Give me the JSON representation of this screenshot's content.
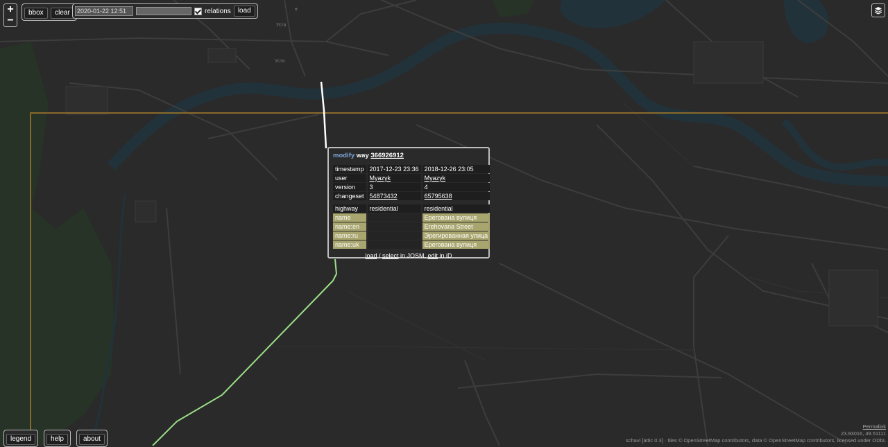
{
  "map": {
    "place_labels": [
      "Устя",
      "Устя"
    ],
    "colors": {
      "background": "#2a2a2a",
      "river": "#23333b",
      "forest": "#253525",
      "road": "#3c3c3c",
      "bbox": "#8a6a2a",
      "way_old": "#ffffff",
      "way_new": "#9ce087"
    }
  },
  "controls": {
    "zoom_in": "+",
    "zoom_out": "−",
    "bbox_label": "bbox",
    "clear_label": "clear",
    "date_value": "2020-01-22 12:51",
    "relations_label": "relations",
    "relations_checked": true,
    "load_label": "load",
    "layers_icon": "layers-icon"
  },
  "popup": {
    "action": "modify",
    "type": "way",
    "id": "366926912",
    "meta": [
      {
        "key": "timestamp",
        "old": "2017-12-23 23:36",
        "new": "2018-12-26 23:05"
      },
      {
        "key": "user",
        "old": "Myazyk",
        "new": "Myazyk"
      },
      {
        "key": "version",
        "old": "3",
        "new": "4"
      },
      {
        "key": "changeset",
        "old": "54873432",
        "new": "65795638"
      }
    ],
    "tags": [
      {
        "key": "highway",
        "old": "residential",
        "new": "residential",
        "changed": false
      },
      {
        "key": "name",
        "old": "",
        "new": "Ерегована вулиця",
        "changed": true
      },
      {
        "key": "name:en",
        "old": "",
        "new": "Erehovana Street",
        "changed": true
      },
      {
        "key": "name:ru",
        "old": "",
        "new": "Эрегированная улица",
        "changed": true
      },
      {
        "key": "name:uk",
        "old": "",
        "new": "Ерегована вулиця",
        "changed": true
      }
    ],
    "footer": {
      "load": "load",
      "sep": " / ",
      "select": "select",
      "in_josm": " in JOSM, ",
      "edit": "edit",
      "in_id": " in iD"
    }
  },
  "bottom": {
    "legend": "legend",
    "help": "help",
    "about": "about"
  },
  "attribution": {
    "permalink": "Permalink",
    "coords": "23.93016, 49.51111",
    "line": "schavi [attic 0.3] · tiles © OpenStreetMap contributors, data © OpenStreetMap contributors, licensed under ODbL"
  }
}
